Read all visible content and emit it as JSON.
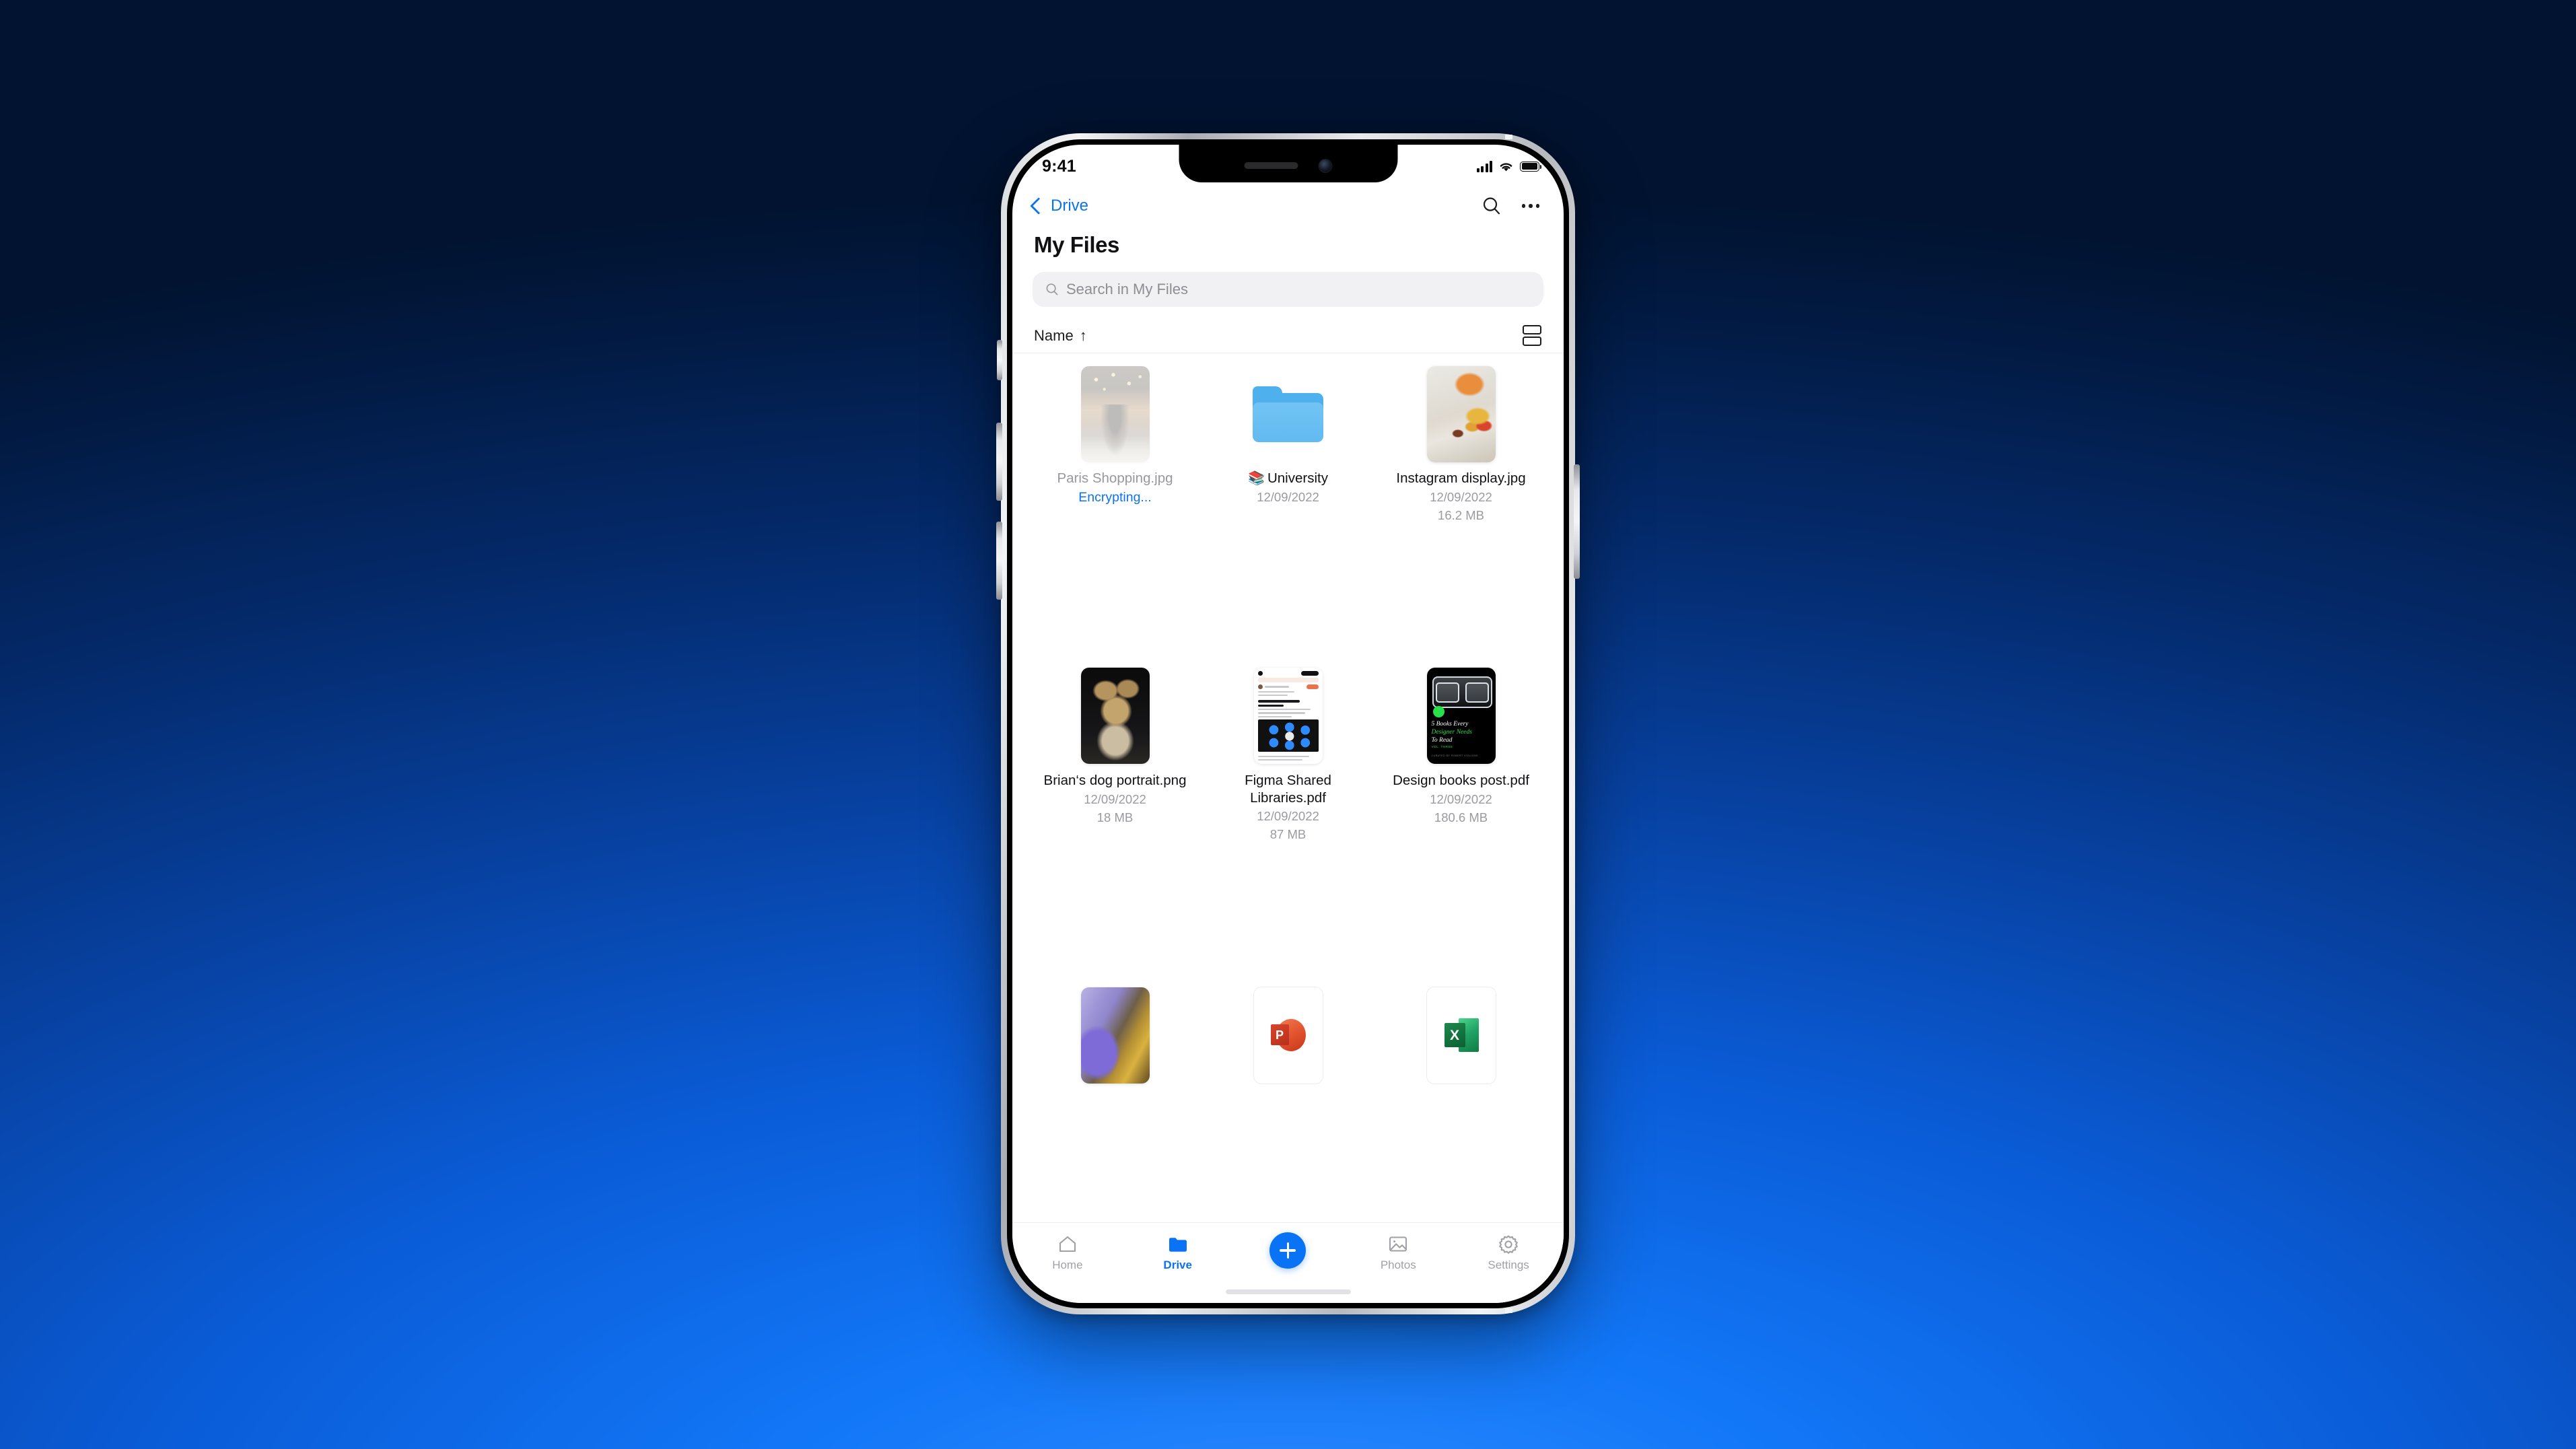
{
  "status_bar": {
    "time": "9:41",
    "cellular_icon": "signal-bars-icon",
    "wifi_icon": "wifi-icon",
    "battery_icon": "battery-full-icon"
  },
  "nav": {
    "back_label": "Drive",
    "back_icon": "chevron-left-icon",
    "search_icon": "search-icon",
    "more_icon": "more-horizontal-icon"
  },
  "header": {
    "title": "My Files"
  },
  "search": {
    "placeholder": "Search in My Files",
    "value": "",
    "icon": "search-icon"
  },
  "sort": {
    "label": "Name",
    "direction_arrow": "↑",
    "view_toggle_icon": "list-view-icon"
  },
  "files": [
    {
      "name": "Paris Shopping.jpg",
      "date": "",
      "size": "",
      "status": "Encrypting...",
      "kind": "image",
      "thumb": "img-paris",
      "dimmed": true
    },
    {
      "name": "University",
      "emoji": "📚",
      "date": "12/09/2022",
      "size": "",
      "status": "",
      "kind": "folder",
      "thumb": "folder-icon",
      "dimmed": false
    },
    {
      "name": "Instagram display.jpg",
      "date": "12/09/2022",
      "size": "16.2 MB",
      "status": "",
      "kind": "image",
      "thumb": "img-autumn",
      "dimmed": false
    },
    {
      "name": "Brian‘s dog portrait.png",
      "date": "12/09/2022",
      "size": "18 MB",
      "status": "",
      "kind": "image",
      "thumb": "img-dog",
      "dimmed": false
    },
    {
      "name": "Figma Shared Libraries.pdf",
      "date": "12/09/2022",
      "size": "87 MB",
      "status": "",
      "kind": "pdf",
      "thumb": "img-medium",
      "dimmed": false
    },
    {
      "name": "Design books post.pdf",
      "date": "12/09/2022",
      "size": "180.6 MB",
      "status": "",
      "kind": "pdf",
      "thumb": "img-books",
      "dimmed": false
    },
    {
      "name": "",
      "date": "",
      "size": "",
      "status": "",
      "kind": "image",
      "thumb": "img-purple",
      "dimmed": false
    },
    {
      "name": "",
      "date": "",
      "size": "",
      "status": "",
      "kind": "powerpoint",
      "thumb": "ppt-icon",
      "dimmed": false
    },
    {
      "name": "",
      "date": "",
      "size": "",
      "status": "",
      "kind": "excel",
      "thumb": "excel-icon",
      "dimmed": false
    }
  ],
  "book_cover": {
    "line1": "5 Books Every",
    "line2": "Designer Needs",
    "line3": "To Read",
    "volume": "VOL. THREE",
    "credit": "CURATED BY ROBERT VIGLIONE"
  },
  "tabs": [
    {
      "label": "Home",
      "icon": "home-icon",
      "active": false
    },
    {
      "label": "Drive",
      "icon": "folder-icon",
      "active": true
    },
    {
      "label": "",
      "icon": "plus-icon",
      "active": false
    },
    {
      "label": "Photos",
      "icon": "photo-icon",
      "active": false
    },
    {
      "label": "Settings",
      "icon": "gear-icon",
      "active": false
    }
  ],
  "colors": {
    "accent_blue": "#0a72f5",
    "folder_blue": "#62BAF2",
    "text_primary": "#111114",
    "text_muted": "#9a9aa0",
    "search_bg": "#F1F1F4",
    "background_dark": "#021A42",
    "background_bright": "#2E8BFF"
  }
}
